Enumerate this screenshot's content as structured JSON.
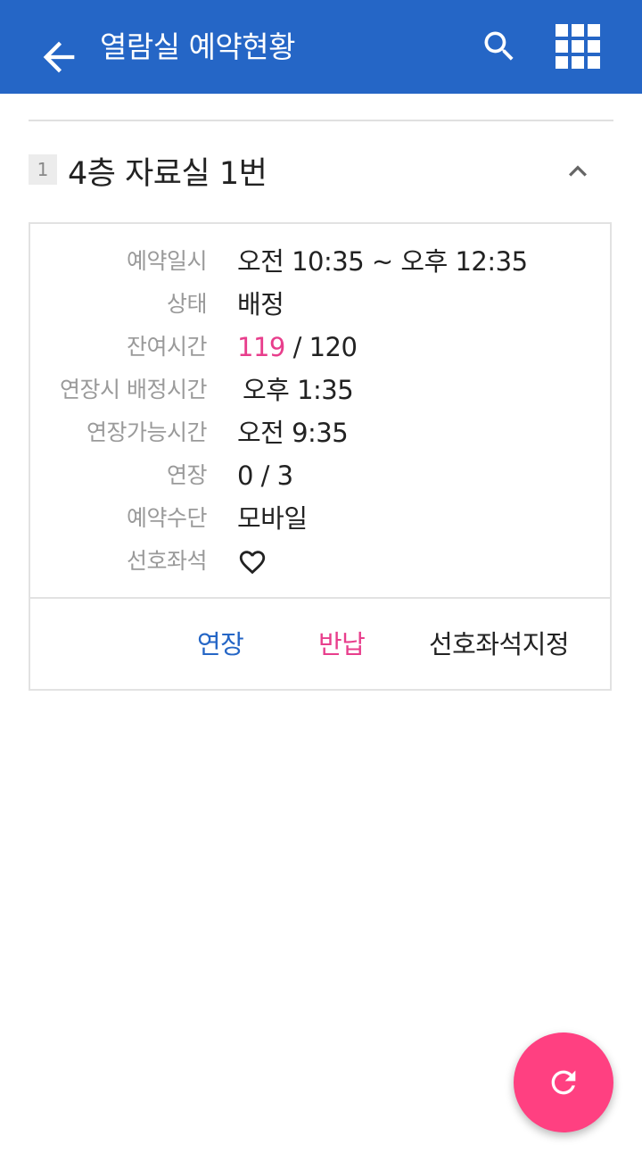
{
  "appbar": {
    "title": "열람실 예약현황",
    "back_icon": "arrow-left-icon",
    "search_icon": "search-icon",
    "apps_icon": "grid-icon"
  },
  "room": {
    "index": "1",
    "name": "4층 자료실 1번",
    "toggle_icon": "chevron-up-icon"
  },
  "details": {
    "reservation_time": {
      "label": "예약일시",
      "value": "오전 10:35 ~ 오후 12:35"
    },
    "status": {
      "label": "상태",
      "value": "배정"
    },
    "remaining_time": {
      "label": "잔여시간",
      "remaining": "119",
      "total": "/ 120"
    },
    "extension_assign_time": {
      "label": "연장시 배정시간",
      "value": "오후 1:35"
    },
    "extendable_time": {
      "label": "연장가능시간",
      "value": "오전 9:35"
    },
    "extension_count": {
      "label": "연장",
      "value": "0 / 3"
    },
    "reservation_method": {
      "label": "예약수단",
      "value": "모바일"
    },
    "preferred_seat": {
      "label": "선호좌석",
      "icon": "heart-outline-icon"
    }
  },
  "actions": {
    "extend": "연장",
    "return": "반납",
    "set_preferred": "선호좌석지정"
  },
  "fab": {
    "icon": "refresh-icon"
  },
  "colors": {
    "primary": "#2566c6",
    "accent": "#e83e8c",
    "fab": "#ff4081"
  }
}
